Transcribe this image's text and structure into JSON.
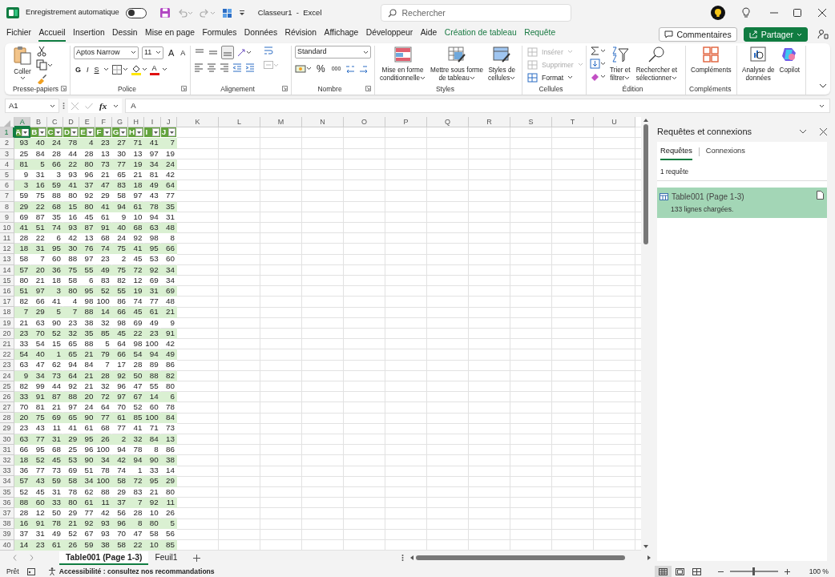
{
  "title_bar": {
    "autosave_label": "Enregistrement automatique",
    "autosave_on": false,
    "undo_disabled": true,
    "redo_disabled": true,
    "document_title": "Classeur1  -  Excel",
    "search": {
      "placeholder": "Rechercher"
    }
  },
  "menu_tabs": [
    {
      "label": "Fichier",
      "selected": false,
      "kind": "plain"
    },
    {
      "label": "Accueil",
      "selected": true,
      "kind": "plain"
    },
    {
      "label": "Insertion",
      "selected": false,
      "kind": "plain"
    },
    {
      "label": "Dessin",
      "selected": false,
      "kind": "plain"
    },
    {
      "label": "Mise en page",
      "selected": false,
      "kind": "plain"
    },
    {
      "label": "Formules",
      "selected": false,
      "kind": "plain"
    },
    {
      "label": "Données",
      "selected": false,
      "kind": "plain"
    },
    {
      "label": "Révision",
      "selected": false,
      "kind": "plain"
    },
    {
      "label": "Affichage",
      "selected": false,
      "kind": "plain"
    },
    {
      "label": "Développeur",
      "selected": false,
      "kind": "plain"
    },
    {
      "label": "Aide",
      "selected": false,
      "kind": "plain"
    },
    {
      "label": "Création de tableau",
      "selected": false,
      "kind": "contextual"
    },
    {
      "label": "Requête",
      "selected": false,
      "kind": "contextual"
    }
  ],
  "header_buttons": {
    "comments": "Commentaires",
    "share": "Partager"
  },
  "ribbon": {
    "clipboard": {
      "paste": "Coller",
      "group": "Presse-papiers"
    },
    "font": {
      "name": "Aptos Narrow",
      "size": "11",
      "grow": "A",
      "shrink": "A",
      "bold": "G",
      "italic": "I",
      "underline": "S",
      "color_letter": "A",
      "group": "Police"
    },
    "alignment": {
      "vertical": [
        {
          "selected": false
        },
        {
          "selected": false
        },
        {
          "selected": true
        }
      ],
      "merge_disabled": true,
      "group": "Alignement"
    },
    "number": {
      "format": "Standard",
      "percent": "%",
      "thousands": "000",
      "group": "Nombre"
    },
    "styles": {
      "items": [
        {
          "lines": [
            "Mise en forme",
            "conditionnelle"
          ]
        },
        {
          "lines": [
            "Mettre sous forme",
            "de tableau"
          ]
        },
        {
          "lines": [
            "Styles de",
            "cellules"
          ]
        }
      ],
      "group": "Styles"
    },
    "cells": {
      "items": [
        {
          "label": "Insérer",
          "disabled": true
        },
        {
          "label": "Supprimer",
          "disabled": true
        },
        {
          "label": "Format",
          "disabled": false
        }
      ],
      "group": "Cellules"
    },
    "editing": {
      "items": [
        {
          "lines": [
            "Trier et",
            "filtrer"
          ]
        },
        {
          "lines": [
            "Rechercher et",
            "sélectionner"
          ]
        }
      ],
      "group": "Édition"
    },
    "addins": {
      "label": "Compléments",
      "group": "Compléments"
    },
    "analysis": {
      "items": [
        {
          "lines": [
            "Analyse de",
            "données"
          ]
        },
        {
          "lines": [
            "Copilot"
          ]
        }
      ]
    }
  },
  "formula_bar": {
    "name_box": "A1",
    "fx": "fx",
    "value": "A"
  },
  "sheet": {
    "column_headers": [
      {
        "label": "A",
        "selected": true
      },
      {
        "label": "B",
        "selected": false
      },
      {
        "label": "C",
        "selected": false
      },
      {
        "label": "D",
        "selected": false
      },
      {
        "label": "E",
        "selected": false
      },
      {
        "label": "F",
        "selected": false
      },
      {
        "label": "G",
        "selected": false
      },
      {
        "label": "H",
        "selected": false
      },
      {
        "label": "I",
        "selected": false
      },
      {
        "label": "J",
        "selected": false
      },
      {
        "label": "K",
        "selected": false
      },
      {
        "label": "L",
        "selected": false
      },
      {
        "label": "M",
        "selected": false
      },
      {
        "label": "N",
        "selected": false
      },
      {
        "label": "O",
        "selected": false
      },
      {
        "label": "P",
        "selected": false
      },
      {
        "label": "Q",
        "selected": false
      },
      {
        "label": "R",
        "selected": false
      },
      {
        "label": "S",
        "selected": false
      },
      {
        "label": "T",
        "selected": false
      },
      {
        "label": "U",
        "selected": false
      }
    ],
    "header_row": {
      "row_header": "1",
      "selected": true
    },
    "table": {
      "columns": [
        "A",
        "B",
        "C",
        "D",
        "E",
        "F",
        "G",
        "H",
        "I",
        "J"
      ],
      "rows": [
        {
          "row_header": "2",
          "cells": [
            "93",
            "40",
            "24",
            "78",
            "4",
            "23",
            "27",
            "71",
            "41",
            "7"
          ]
        },
        {
          "row_header": "3",
          "cells": [
            "25",
            "84",
            "28",
            "44",
            "28",
            "13",
            "30",
            "13",
            "97",
            "19"
          ]
        },
        {
          "row_header": "4",
          "cells": [
            "81",
            "5",
            "66",
            "22",
            "80",
            "73",
            "77",
            "19",
            "34",
            "24"
          ]
        },
        {
          "row_header": "5",
          "cells": [
            "9",
            "31",
            "3",
            "93",
            "96",
            "21",
            "65",
            "21",
            "81",
            "42"
          ]
        },
        {
          "row_header": "6",
          "cells": [
            "3",
            "16",
            "59",
            "41",
            "37",
            "47",
            "83",
            "18",
            "49",
            "64"
          ]
        },
        {
          "row_header": "7",
          "cells": [
            "59",
            "75",
            "88",
            "80",
            "92",
            "29",
            "58",
            "97",
            "43",
            "77"
          ]
        },
        {
          "row_header": "8",
          "cells": [
            "29",
            "22",
            "68",
            "15",
            "80",
            "41",
            "94",
            "61",
            "78",
            "35"
          ]
        },
        {
          "row_header": "9",
          "cells": [
            "69",
            "87",
            "35",
            "16",
            "45",
            "61",
            "9",
            "10",
            "94",
            "31"
          ]
        },
        {
          "row_header": "10",
          "cells": [
            "41",
            "51",
            "74",
            "93",
            "87",
            "91",
            "40",
            "68",
            "63",
            "48"
          ]
        },
        {
          "row_header": "11",
          "cells": [
            "28",
            "22",
            "6",
            "42",
            "13",
            "68",
            "24",
            "92",
            "98",
            "8"
          ]
        },
        {
          "row_header": "12",
          "cells": [
            "18",
            "31",
            "95",
            "30",
            "76",
            "74",
            "75",
            "41",
            "95",
            "66"
          ]
        },
        {
          "row_header": "13",
          "cells": [
            "58",
            "7",
            "60",
            "88",
            "97",
            "23",
            "2",
            "45",
            "53",
            "60"
          ]
        },
        {
          "row_header": "14",
          "cells": [
            "57",
            "20",
            "36",
            "75",
            "55",
            "49",
            "75",
            "72",
            "92",
            "34"
          ]
        },
        {
          "row_header": "15",
          "cells": [
            "80",
            "21",
            "18",
            "58",
            "6",
            "83",
            "82",
            "12",
            "69",
            "34"
          ]
        },
        {
          "row_header": "16",
          "cells": [
            "51",
            "97",
            "3",
            "80",
            "95",
            "52",
            "55",
            "19",
            "31",
            "69"
          ]
        },
        {
          "row_header": "17",
          "cells": [
            "82",
            "66",
            "41",
            "4",
            "98",
            "100",
            "86",
            "74",
            "77",
            "48"
          ]
        },
        {
          "row_header": "18",
          "cells": [
            "7",
            "29",
            "5",
            "7",
            "88",
            "14",
            "66",
            "45",
            "61",
            "21"
          ]
        },
        {
          "row_header": "19",
          "cells": [
            "21",
            "63",
            "90",
            "23",
            "38",
            "32",
            "98",
            "69",
            "49",
            "9"
          ]
        },
        {
          "row_header": "20",
          "cells": [
            "23",
            "70",
            "52",
            "32",
            "35",
            "85",
            "45",
            "22",
            "23",
            "91"
          ]
        },
        {
          "row_header": "21",
          "cells": [
            "33",
            "54",
            "15",
            "65",
            "88",
            "5",
            "64",
            "98",
            "100",
            "42"
          ]
        },
        {
          "row_header": "22",
          "cells": [
            "54",
            "40",
            "1",
            "65",
            "21",
            "79",
            "66",
            "54",
            "94",
            "49"
          ]
        },
        {
          "row_header": "23",
          "cells": [
            "63",
            "47",
            "62",
            "94",
            "84",
            "7",
            "17",
            "28",
            "89",
            "86"
          ]
        },
        {
          "row_header": "24",
          "cells": [
            "9",
            "34",
            "73",
            "64",
            "21",
            "28",
            "92",
            "50",
            "88",
            "82"
          ]
        },
        {
          "row_header": "25",
          "cells": [
            "82",
            "99",
            "44",
            "92",
            "21",
            "32",
            "96",
            "47",
            "55",
            "80"
          ]
        },
        {
          "row_header": "26",
          "cells": [
            "33",
            "91",
            "87",
            "88",
            "20",
            "72",
            "97",
            "67",
            "14",
            "6"
          ]
        },
        {
          "row_header": "27",
          "cells": [
            "70",
            "81",
            "21",
            "97",
            "24",
            "64",
            "70",
            "52",
            "60",
            "78"
          ]
        },
        {
          "row_header": "28",
          "cells": [
            "20",
            "75",
            "69",
            "65",
            "90",
            "77",
            "61",
            "85",
            "100",
            "84"
          ]
        },
        {
          "row_header": "29",
          "cells": [
            "23",
            "43",
            "11",
            "41",
            "61",
            "68",
            "77",
            "41",
            "71",
            "73"
          ]
        },
        {
          "row_header": "30",
          "cells": [
            "63",
            "77",
            "31",
            "29",
            "95",
            "26",
            "2",
            "32",
            "84",
            "13"
          ]
        },
        {
          "row_header": "31",
          "cells": [
            "66",
            "95",
            "68",
            "25",
            "96",
            "100",
            "94",
            "78",
            "8",
            "86"
          ]
        },
        {
          "row_header": "32",
          "cells": [
            "18",
            "52",
            "45",
            "53",
            "90",
            "34",
            "42",
            "94",
            "90",
            "38"
          ]
        },
        {
          "row_header": "33",
          "cells": [
            "36",
            "77",
            "73",
            "69",
            "51",
            "78",
            "74",
            "1",
            "33",
            "14"
          ]
        },
        {
          "row_header": "34",
          "cells": [
            "57",
            "43",
            "59",
            "58",
            "34",
            "100",
            "58",
            "72",
            "95",
            "29"
          ]
        },
        {
          "row_header": "35",
          "cells": [
            "52",
            "45",
            "31",
            "78",
            "62",
            "88",
            "29",
            "83",
            "21",
            "80"
          ]
        },
        {
          "row_header": "36",
          "cells": [
            "88",
            "60",
            "33",
            "80",
            "61",
            "11",
            "37",
            "7",
            "92",
            "11"
          ]
        },
        {
          "row_header": "37",
          "cells": [
            "28",
            "12",
            "50",
            "29",
            "77",
            "42",
            "56",
            "28",
            "10",
            "26"
          ]
        },
        {
          "row_header": "38",
          "cells": [
            "16",
            "91",
            "78",
            "21",
            "92",
            "93",
            "96",
            "8",
            "80",
            "5"
          ]
        },
        {
          "row_header": "39",
          "cells": [
            "37",
            "31",
            "49",
            "52",
            "67",
            "93",
            "70",
            "47",
            "58",
            "56"
          ]
        },
        {
          "row_header": "40",
          "cells": [
            "14",
            "23",
            "61",
            "26",
            "59",
            "38",
            "58",
            "22",
            "10",
            "85"
          ]
        }
      ]
    }
  },
  "sheet_tabs": [
    {
      "label": "Table001 (Page 1-3)",
      "selected": true
    },
    {
      "label": "Feuil1",
      "selected": false
    }
  ],
  "queries_panel": {
    "title": "Requêtes et connexions",
    "tabs": [
      {
        "label": "Requêtes",
        "selected": true
      },
      {
        "label": "Connexions",
        "selected": false
      }
    ],
    "count": "1 requête",
    "queries": [
      {
        "name": "Table001 (Page 1-3)",
        "detail": "133 lignes chargées.",
        "selected": true
      }
    ]
  },
  "status_bar": {
    "state": "Prêt",
    "accessibility": "Accessibilité : consultez nos recommandations",
    "views": [
      {
        "selected": true
      },
      {
        "selected": false
      },
      {
        "selected": false
      }
    ],
    "zoom": {
      "level": 0.5
    },
    "zoom_label": "100 %"
  }
}
